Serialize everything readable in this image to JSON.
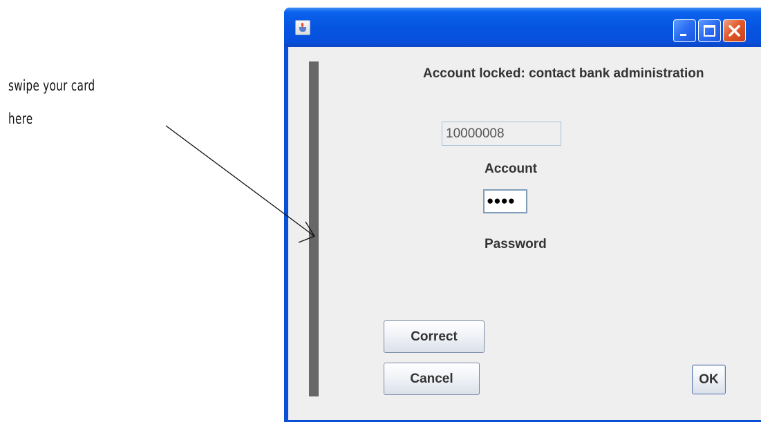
{
  "annotation": {
    "line1": "swipe your card",
    "line2": "here"
  },
  "window": {
    "title": "",
    "icon": "java-coffee-cup-icon",
    "controls": {
      "minimize": "minimize-icon",
      "maximize": "maximize-icon",
      "close": "close-icon"
    }
  },
  "dialog": {
    "status_message": "Account locked: contact bank administration",
    "account_value": "10000008",
    "account_label": "Account",
    "password_value": "●●●●",
    "password_label": "Password",
    "buttons": {
      "correct": "Correct",
      "cancel": "Cancel",
      "ok": "OK"
    }
  },
  "colors": {
    "titlebar": "#0655e0",
    "close_button": "#e05a2b",
    "client_background": "#efefef",
    "card_slot": "#676767"
  }
}
